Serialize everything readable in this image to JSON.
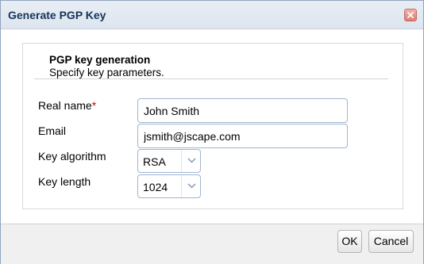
{
  "dialog": {
    "title": "Generate PGP Key",
    "close_icon": "close-icon"
  },
  "section": {
    "title": "PGP key generation",
    "subtitle": "Specify key parameters."
  },
  "form": {
    "real_name": {
      "label": "Real name",
      "required_marker": "*",
      "value": "John Smith"
    },
    "email": {
      "label": "Email",
      "value": "jsmith@jscape.com"
    },
    "key_algorithm": {
      "label": "Key algorithm",
      "value": "RSA"
    },
    "key_length": {
      "label": "Key length",
      "value": "1024"
    }
  },
  "buttons": {
    "ok": "OK",
    "cancel": "Cancel"
  },
  "colors": {
    "title_text": "#15345a",
    "required": "#d40000",
    "input_border": "#9fb5cf"
  }
}
